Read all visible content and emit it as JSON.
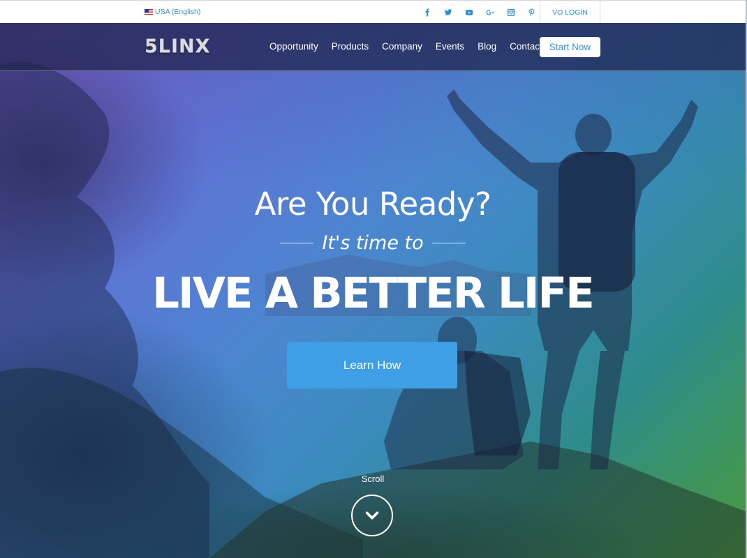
{
  "topbar": {
    "locale": "USA (English)",
    "flag_icon": "us-flag-icon",
    "socials": [
      "facebook-icon",
      "twitter-icon",
      "youtube-icon",
      "google-plus-icon",
      "instagram-icon",
      "pinterest-icon"
    ],
    "vo_login": "VO LOGIN"
  },
  "header": {
    "logo": "5LINX",
    "nav": [
      "Opportunity",
      "Products",
      "Company",
      "Events",
      "Blog",
      "Contact"
    ],
    "cta": "Start Now"
  },
  "hero": {
    "headline": "Are You Ready?",
    "tagline": "It's time to",
    "title": "LIVE A BETTER LIFE",
    "button": "Learn How",
    "scroll_label": "Scroll",
    "scroll_icon": "chevron-down-icon"
  },
  "colors": {
    "accent": "#3f9fe6",
    "link": "#2f8fd6",
    "nav_bg": "#1e234b"
  }
}
